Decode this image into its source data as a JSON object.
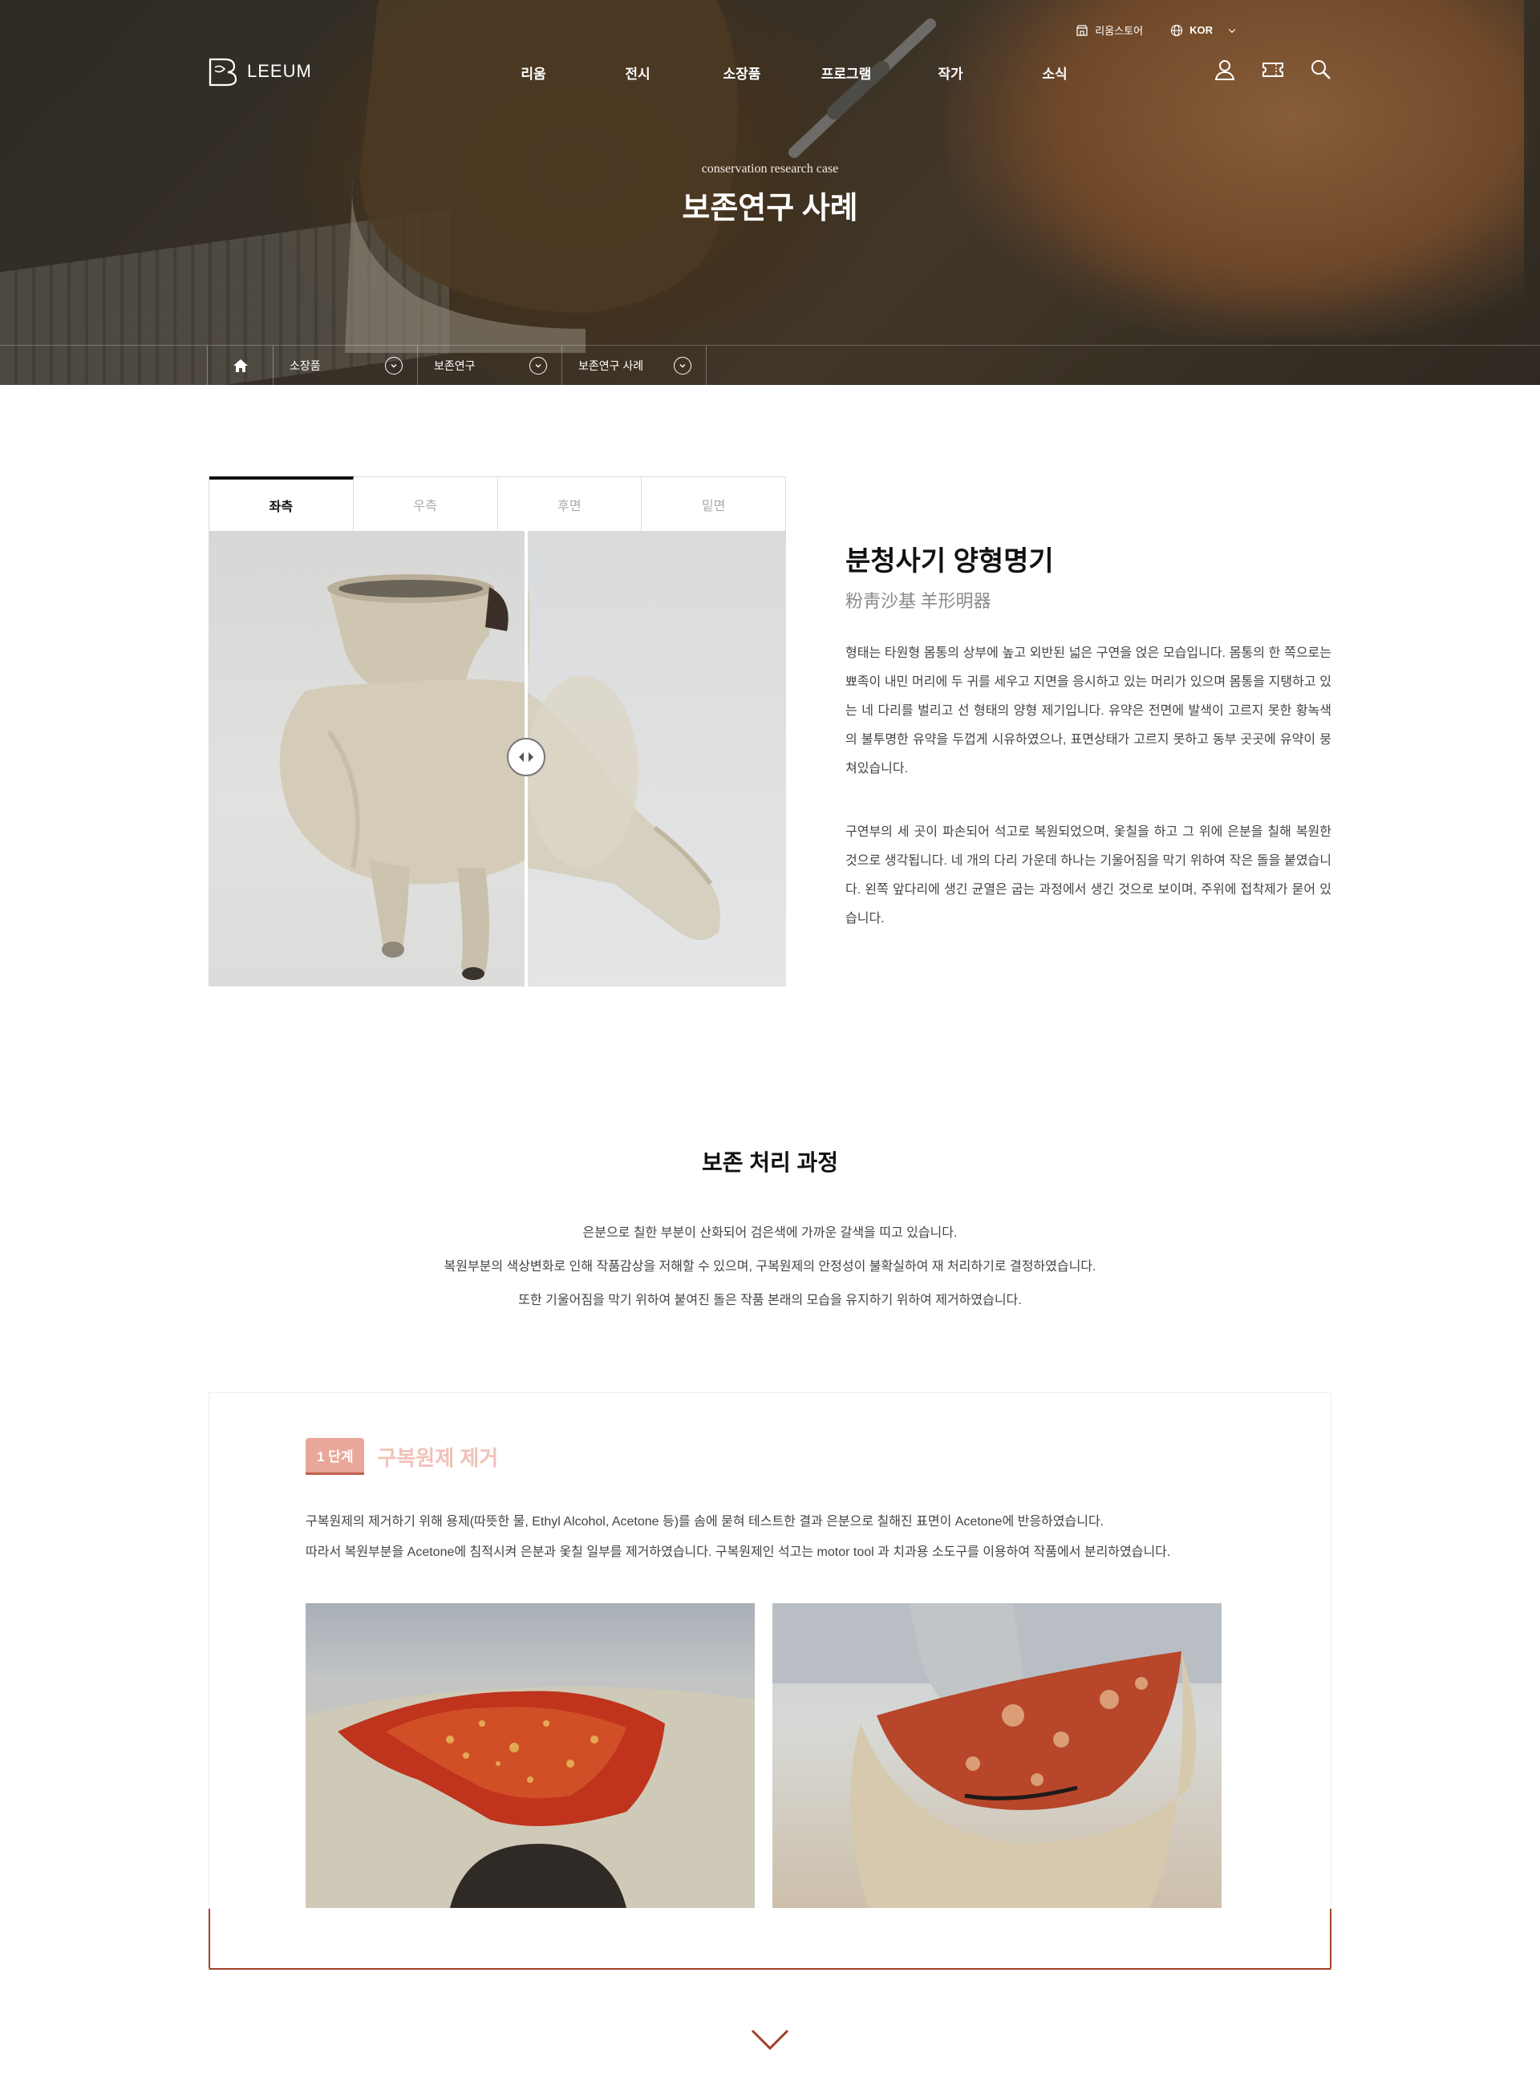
{
  "header": {
    "logo_text": "LEEUM",
    "util": {
      "store_label": "리움스토어",
      "lang_label": "KOR"
    },
    "nav": [
      "리움",
      "전시",
      "소장품",
      "프로그램",
      "작가",
      "소식"
    ],
    "icons": [
      "user-icon",
      "ticket-icon",
      "search-icon"
    ]
  },
  "hero": {
    "subtitle": "conservation research case",
    "title": "보존연구 사례"
  },
  "breadcrumb": {
    "items": [
      "소장품",
      "보존연구",
      "보존연구 사례"
    ]
  },
  "artwork": {
    "tabs": [
      "좌측",
      "우측",
      "후면",
      "밑면"
    ],
    "active_tab": "좌측",
    "title": "분청사기 양형명기",
    "hanja": "粉靑沙基 羊形明器",
    "description_1": "형태는 타원형 몸통의 상부에 높고 외반된 넓은 구연을 얹은 모습입니다. 몸통의 한 쪽으로는 뾰족이 내민 머리에 두 귀를 세우고 지면을 응시하고 있는 머리가 있으며 몸통을 지탱하고 있는 네 다리를 벌리고 선 형태의 양형 제기입니다. 유약은 전면에 발색이 고르지 못한 황녹색의 불투명한 유약을 두껍게 시유하였으나, 표면상태가 고르지 못하고 동부 곳곳에 유약이 뭉쳐있습니다.",
    "description_2": "구연부의 세 곳이 파손되어 석고로 복원되었으며, 옻칠을 하고 그 위에 은분을 칠해 복원한 것으로 생각됩니다. 네 개의 다리 가운데 하나는 기울어짐을 막기 위하여 작은 돌을 붙였습니다. 왼쪽 앞다리에 생긴 균열은 굽는 과정에서 생긴 것으로 보이며, 주위에 접착제가 묻어 있습니다."
  },
  "process": {
    "title": "보존 처리 과정",
    "lines": [
      "은분으로 칠한 부분이 산화되어 검은색에 가까운 갈색을 띠고 있습니다.",
      "복원부분의 색상변화로 인해 작품감상을 저해할 수 있으며, 구복원제의 안정성이 불확실하여 재 처리하기로 결정하였습니다.",
      "또한 기울어짐을 막기 위하여 붙여진 돌은 작품 본래의 모습을 유지하기 위하여 제거하였습니다."
    ],
    "step": {
      "badge": "1 단계",
      "name": "구복원제 제거",
      "desc_1": "구복원제의 제거하기 위해 용제(따뜻한 물, Ethyl Alcohol, Acetone 등)를 솜에 묻혀 테스트한 결과 은분으로 칠해진 표면이 Acetone에 반응하였습니다.",
      "desc_2": "따라서 복원부분을 Acetone에 침적시켜 은분과 옻칠 일부를 제거하였습니다. 구복원제인 석고는 motor tool 과 치과용 소도구를 이용하여 작품에서 분리하였습니다."
    }
  },
  "colors": {
    "accent": "#a0402a",
    "step_badge": "#e9a79a",
    "step_name": "#f0c2b8"
  }
}
